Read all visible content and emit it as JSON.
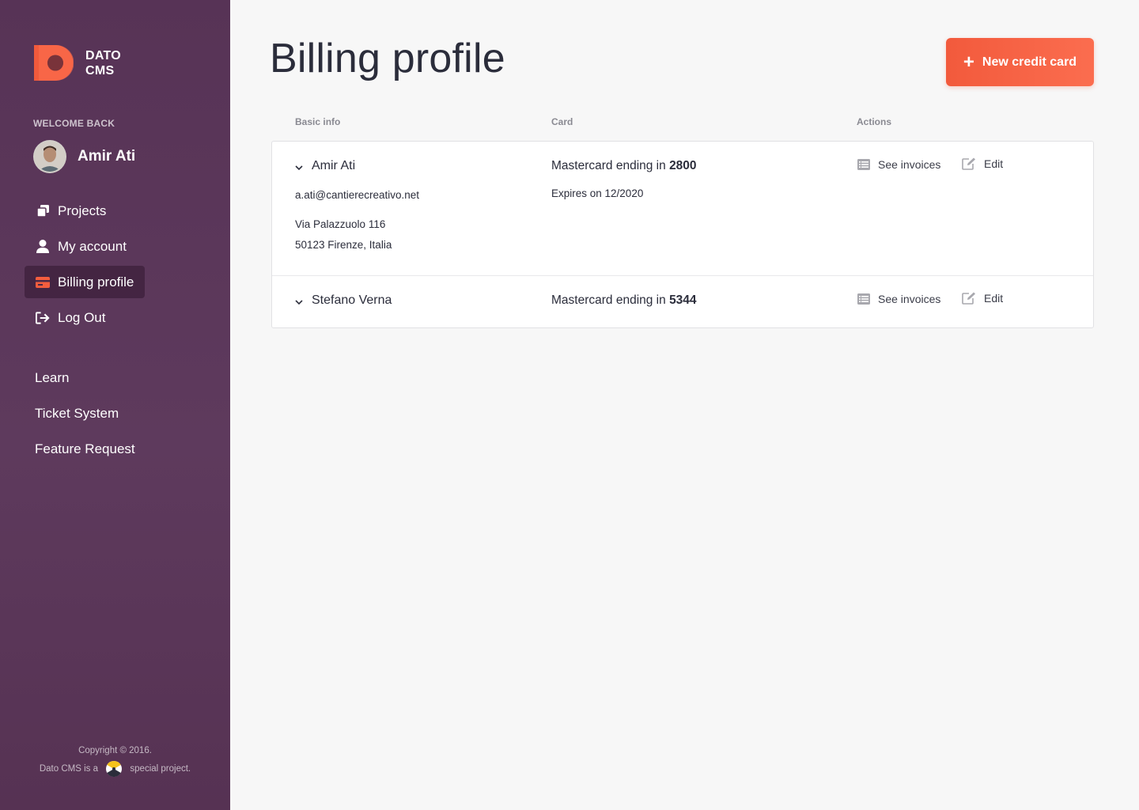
{
  "brand": {
    "line1": "DATO",
    "line2": "CMS"
  },
  "sidebar": {
    "welcome": "WELCOME BACK",
    "user_name": "Amir Ati",
    "nav": [
      {
        "label": "Projects",
        "icon": "projects-icon"
      },
      {
        "label": "My account",
        "icon": "user-icon"
      },
      {
        "label": "Billing profile",
        "icon": "credit-card-icon",
        "active": true
      },
      {
        "label": "Log Out",
        "icon": "logout-icon"
      }
    ],
    "links": [
      {
        "label": "Learn"
      },
      {
        "label": "Ticket System"
      },
      {
        "label": "Feature Request"
      }
    ],
    "footer": {
      "copyright": "Copyright © 2016.",
      "tagline_before": "Dato CMS is a",
      "tagline_after": "special project."
    }
  },
  "main": {
    "title": "Billing profile",
    "new_card_label": "New credit card",
    "columns": {
      "basic_info": "Basic info",
      "card": "Card",
      "actions": "Actions"
    },
    "rows": [
      {
        "name": "Amir Ati",
        "email": "a.ati@cantierecreativo.net",
        "address1": "Via Palazzuolo 116",
        "address2": "50123 Firenze, Italia",
        "card_prefix": "Mastercard ending in",
        "card_last4": "2800",
        "expires": "Expires on 12/2020",
        "see_invoices": "See invoices",
        "edit": "Edit"
      },
      {
        "name": "Stefano Verna",
        "card_prefix": "Mastercard ending in",
        "card_last4": "5344",
        "see_invoices": "See invoices",
        "edit": "Edit"
      }
    ]
  },
  "colors": {
    "sidebar": "#5a3658",
    "accent": "#f45d3e",
    "background": "#f7f7f7"
  }
}
